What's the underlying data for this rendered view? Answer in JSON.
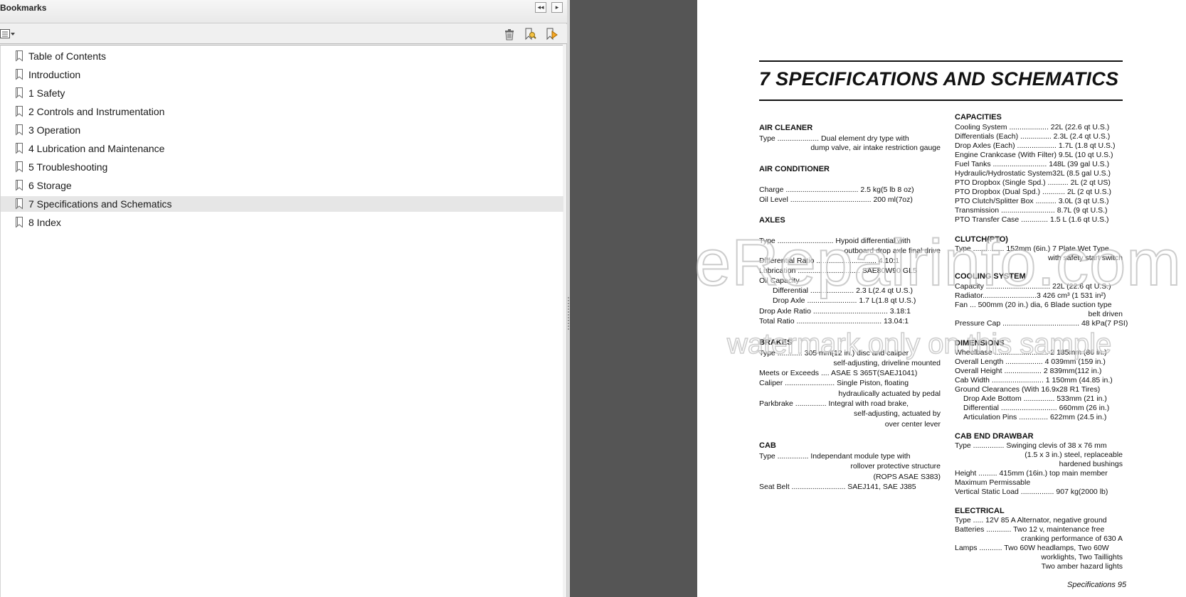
{
  "panel": {
    "title": "Bookmarks",
    "collapse_label": "◂◂",
    "expand_label": "▸",
    "icons": [
      "options-menu-icon",
      "trash-icon",
      "find-bookmark-icon",
      "new-bookmark-icon"
    ]
  },
  "bookmarks": [
    {
      "label": "Table of Contents",
      "selected": false
    },
    {
      "label": "Introduction",
      "selected": false
    },
    {
      "label": "1 Safety",
      "selected": false
    },
    {
      "label": "2 Controls and Instrumentation",
      "selected": false
    },
    {
      "label": "3 Operation",
      "selected": false
    },
    {
      "label": "4 Lubrication and Maintenance",
      "selected": false
    },
    {
      "label": "5 Troubleshooting",
      "selected": false
    },
    {
      "label": "6 Storage",
      "selected": false
    },
    {
      "label": "7 Specifications and Schematics",
      "selected": true
    },
    {
      "label": "8 Index",
      "selected": false
    }
  ],
  "colors": {
    "selected_bg": "#e6e6e6",
    "doc_bg": "#555555"
  },
  "doc": {
    "title": "7 SPECIFICATIONS AND SCHEMATICS",
    "footer": "Specifications  95",
    "watermark_1": "eRepairinfo.com",
    "watermark_2": "watermark only on this sample",
    "left": {
      "air_cleaner": {
        "h": "AIR CLEANER",
        "l1": "Type ....................  Dual element dry type with",
        "l2": "dump valve, air intake restriction gauge"
      },
      "air_conditioner": {
        "h": "AIR CONDITIONER",
        "l1": "Charge ...................................  2.5 kg(5 lb 8 oz)",
        "l2": "Oil Level .......................................  200 ml(7oz)"
      },
      "axles": {
        "h": "AXLES",
        "l1": "Type ...........................  Hypoid differential with",
        "l2": "outboard drop axle final drive",
        "l3": "Differential Ratio .............................  4.10:1",
        "l4": "Lubrication ..............................  SAE80W90 GL5",
        "l5": "Oil Capacity",
        "l6": "Differential  .....................  2.3 L(2.4 qt U.S.)",
        "l7": "Drop Axle ........................  1.7 L(1.8 qt U.S.)",
        "l8": "Drop Axle Ratio ....................................  3.18:1",
        "l9": "Total Ratio .........................................  13.04:1"
      },
      "brakes": {
        "h": "BRAKES",
        "l1": "Type ............  305 mm(12 in.) disc and caliper",
        "l2": "self-adjusting, driveline mounted",
        "l3": "Meets or Exceeds ....  ASAE S 365T(SAEJ1041)",
        "l4": "Caliper ........................  Single Piston, floating",
        "l5": "hydraulically actuated by pedal",
        "l6": "Parkbrake ...............  Integral with road brake,",
        "l7": "self-adjusting, actuated by",
        "l8": "over center lever"
      },
      "cab": {
        "h": "CAB",
        "l1": "Type ...............  Independant module type with",
        "l2": "rollover protective structure",
        "l3": "(ROPS ASAE S383)",
        "l4": "Seat Belt ..........................  SAEJ141, SAE J385"
      }
    },
    "right": {
      "capacities": {
        "h": "CAPACITIES",
        "l1": "Cooling System ...................  22L (22.6 qt U.S.)",
        "l2": "Differentials (Each) ...............  2.3L (2.4 qt U.S.)",
        "l3": "Drop Axles (Each) ...................  1.7L (1.8 qt U.S.)",
        "l4": "Engine Crankcase (With Filter) 9.5L (10 qt U.S.)",
        "l5": "Fuel Tanks ..........................  148L (39 gal U.S.)",
        "l6": "Hydraulic/Hydrostatic System32L (8.5 gal U.S.)",
        "l7": "PTO Dropbox (Single Spd.) ..........  2L (2 qt US)",
        "l8": "PTO Dropbox (Dual Spd.) ...........  2L (2 qt U.S.)",
        "l9": "PTO Clutch/Splitter Box ..........  3.0L (3 qt U.S.)",
        "l10": "Transmission ..........................  8.7L (9 qt U.S.)",
        "l11": "PTO Transfer Case .............  1.5 L (1.6 qt U.S.)"
      },
      "clutch": {
        "h": "CLUTCH(PTO)",
        "l1": "Type ...............  152mm (6in.) 7 Plate Wet Type",
        "l2": "with safety start switch"
      },
      "cooling": {
        "h": "COOLING SYSTEM",
        "l1": "Capacity ...............................  22L (22.6 qt U.S.)",
        "l2": "Radiator..........................3  426 cm³ (1 531 in²)",
        "l3": "Fan ... 500mm (20 in.) dia, 6 Blade suction type",
        "l4": "belt driven",
        "l5": "Pressure Cap .....................................  48 kPa(7 PSI)"
      },
      "dimensions": {
        "h": "DIMENSIONS",
        "l1": "Wheelbase ..........................  2  185mm (86 in.)",
        "l2": "Overall Length ..................  4  039mm (159 in.)",
        "l3": "Overall Height ..................  2  839mm(112 in.)",
        "l4": "Cab Width .........................  1  150mm (44.85 in.)",
        "l5": "Ground Clearances (With 16.9x28 R1 Tires)",
        "l6": "Drop Axle Bottom ...............  533mm (21 in.)",
        "l7": "Differential ...........................  660mm (26 in.)",
        "l8": "Articulation Pins ..............  622mm (24.5 in.)"
      },
      "drawbar": {
        "h": "CAB END DRAWBAR",
        "l1": "Type ...............  Swinging clevis of 38 x 76 mm",
        "l2": "(1.5 x 3 in.) steel, replaceable",
        "l3": "hardened bushings",
        "l4": "Height .........  415mm (16in.) top main member",
        "l5": "Maximum Permissable",
        "l6": "Vertical Static Load ................  907 kg(2000 lb)"
      },
      "electrical": {
        "h": "ELECTRICAL",
        "l1": "Type .....  12V 85 A Alternator, negative ground",
        "l2": "Batteries ............  Two 12 v, maintenance free",
        "l3": "cranking performance of 630 A",
        "l4": "Lamps ...........  Two 60W headlamps, Two 60W",
        "l5": "worklights, Two Taillights",
        "l6": "Two amber hazard lights"
      }
    }
  }
}
